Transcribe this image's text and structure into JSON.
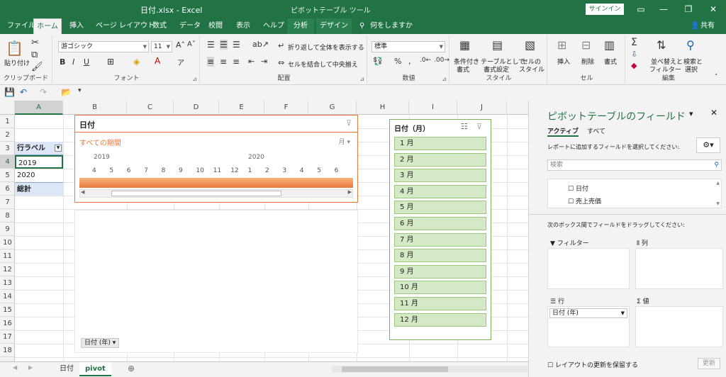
{
  "titlebar": {
    "title": "日付.xlsx  -  Excel",
    "context_tools": "ピボットテーブル ツール",
    "signin": "サインイン"
  },
  "tabs": [
    {
      "label": "ファイル"
    },
    {
      "label": "ホーム"
    },
    {
      "label": "挿入"
    },
    {
      "label": "ページ レイアウト"
    },
    {
      "label": "数式"
    },
    {
      "label": "データ"
    },
    {
      "label": "校閲"
    },
    {
      "label": "表示"
    },
    {
      "label": "ヘルプ"
    },
    {
      "label": "分析"
    },
    {
      "label": "デザイン"
    },
    {
      "label": "何をしますか"
    }
  ],
  "share": "共有",
  "ribbon": {
    "clipboard": {
      "paste": "貼り付け",
      "label": "クリップボード"
    },
    "font": {
      "name": "游ゴシック",
      "size": "11",
      "label": "フォント"
    },
    "align": {
      "wrap": "折り返して全体を表示する",
      "merge": "セルを結合して中央揃え",
      "label": "配置"
    },
    "number": {
      "format": "標準",
      "label": "数値"
    },
    "style": {
      "cond1": "条件付き",
      "cond2": "書式",
      "table1": "テーブルとして",
      "table2": "書式設定",
      "cell1": "セルの",
      "cell2": "スタイル",
      "label": "スタイル"
    },
    "cells": {
      "insert": "挿入",
      "delete": "削除",
      "format": "書式",
      "label": "セル"
    },
    "edit": {
      "sort1": "並べ替えと",
      "sort2": "フィルター",
      "find1": "検索と",
      "find2": "選択",
      "label": "編集"
    }
  },
  "grid": {
    "columns": [
      "A",
      "B",
      "C",
      "D",
      "E",
      "F",
      "G",
      "H",
      "I",
      "J"
    ],
    "rows": [
      "1",
      "2",
      "3",
      "4",
      "5",
      "6",
      "7",
      "8",
      "9",
      "10",
      "11",
      "12",
      "13",
      "14",
      "15",
      "16",
      "17",
      "18"
    ],
    "cells": {
      "a3": "行ラベル",
      "a4": "2019",
      "a5": "2020",
      "a6": "総計"
    }
  },
  "timeline": {
    "title": "日付",
    "period": "すべての期間",
    "level": "月",
    "year1": "2019",
    "year2": "2020",
    "months": [
      "4",
      "5",
      "6",
      "7",
      "8",
      "9",
      "10",
      "11",
      "12",
      "1",
      "2",
      "3",
      "4",
      "5",
      "6"
    ]
  },
  "chart_field": "日付 (年)",
  "slicer": {
    "title": "日付（月）",
    "items": [
      "1 月",
      "2 月",
      "3 月",
      "4 月",
      "5 月",
      "6 月",
      "7 月",
      "8 月",
      "9 月",
      "10 月",
      "11 月",
      "12 月"
    ]
  },
  "pane": {
    "title": "ピボットテーブルのフィールド",
    "tab_active": "アクティブ",
    "tab_all": "すべて",
    "instruction": "レポートに追加するフィールドを選択してください:",
    "search_placeholder": "検索",
    "fields": [
      "日付",
      "売上売価"
    ],
    "drag_instruction": "次のボックス間でフィールドをドラッグしてください:",
    "filter": "フィルター",
    "columns": "列",
    "rows": "行",
    "values": "値",
    "row_item": "日付 (年)",
    "defer": "レイアウトの更新を保留する",
    "update": "更新"
  },
  "sheets": [
    {
      "label": "日付"
    },
    {
      "label": "pivot"
    }
  ],
  "colors": {
    "excel_green": "#217346",
    "timeline_orange": "#e8793a",
    "slicer_green": "#d6e9c6"
  }
}
